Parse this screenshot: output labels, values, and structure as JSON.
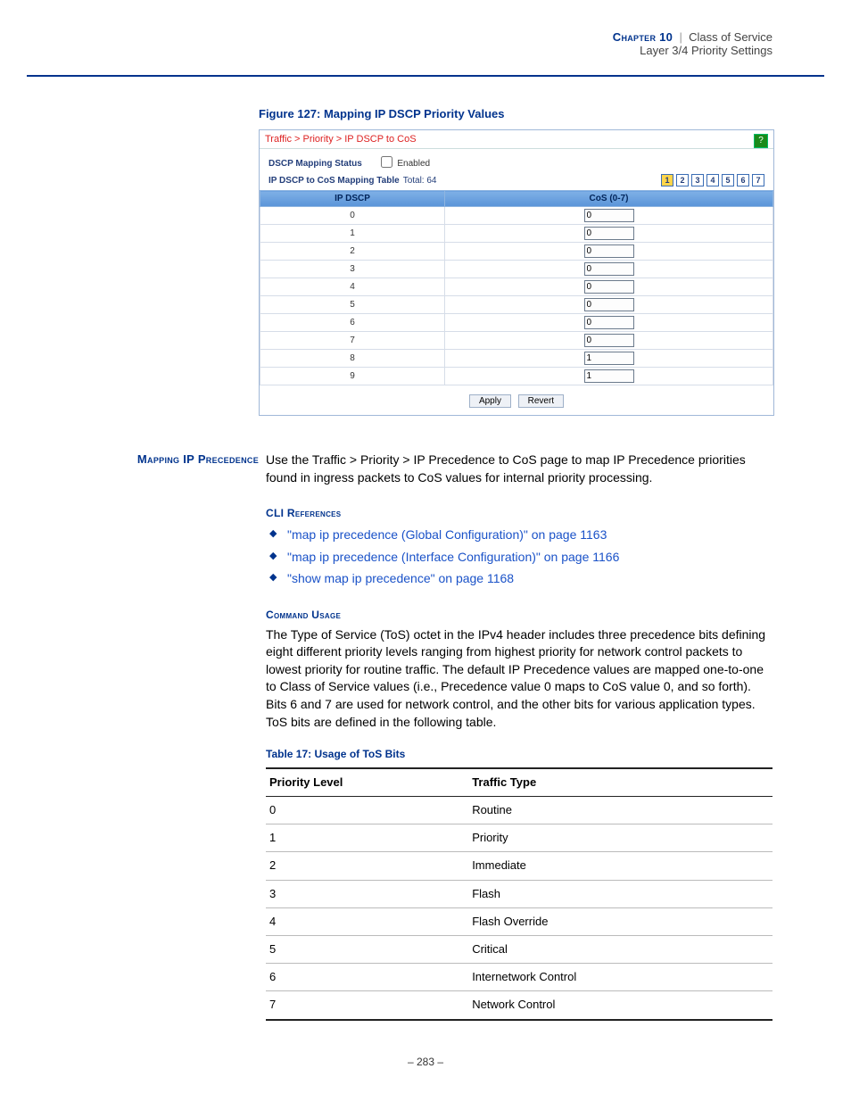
{
  "header": {
    "chapter": "Chapter 10",
    "title": "Class of Service",
    "subtitle": "Layer 3/4 Priority Settings"
  },
  "figure": {
    "caption": "Figure 127:  Mapping IP DSCP Priority Values",
    "breadcrumb": "Traffic > Priority > IP DSCP to CoS",
    "status_label": "DSCP Mapping Status",
    "enabled_label": "Enabled",
    "table_title": "IP DSCP to CoS Mapping Table",
    "total": "Total: 64",
    "pages": [
      "1",
      "2",
      "3",
      "4",
      "5",
      "6",
      "7"
    ],
    "col1": "IP DSCP",
    "col2": "CoS (0-7)",
    "rows": [
      {
        "dscp": "0",
        "cos": "0"
      },
      {
        "dscp": "1",
        "cos": "0"
      },
      {
        "dscp": "2",
        "cos": "0"
      },
      {
        "dscp": "3",
        "cos": "0"
      },
      {
        "dscp": "4",
        "cos": "0"
      },
      {
        "dscp": "5",
        "cos": "0"
      },
      {
        "dscp": "6",
        "cos": "0"
      },
      {
        "dscp": "7",
        "cos": "0"
      },
      {
        "dscp": "8",
        "cos": "1"
      },
      {
        "dscp": "9",
        "cos": "1"
      }
    ],
    "apply": "Apply",
    "revert": "Revert"
  },
  "section": {
    "heading": "Mapping IP Precedence",
    "intro": "Use the Traffic > Priority > IP Precedence to CoS page to map IP Precedence priorities found in ingress packets to CoS values for internal priority processing.",
    "cli_head": "CLI References",
    "cli": [
      "\"map ip precedence (Global Configuration)\" on page 1163",
      "\"map ip precedence (Interface Configuration)\" on page 1166",
      "\"show map ip precedence\" on page 1168"
    ],
    "cmd_head": "Command Usage",
    "cmd_body": "The Type of Service (ToS) octet in the IPv4 header includes three precedence bits defining eight different priority levels ranging from highest priority for network control packets to lowest priority for routine traffic. The default IP Precedence values are mapped one-to-one to Class of Service values (i.e., Precedence value 0 maps to CoS value 0, and so forth). Bits 6 and 7 are used for network control, and the other bits for various application types. ToS bits are defined in the following table."
  },
  "table": {
    "caption": "Table 17: Usage of ToS Bits",
    "h1": "Priority Level",
    "h2": "Traffic Type",
    "rows": [
      {
        "p": "0",
        "t": "Routine"
      },
      {
        "p": "1",
        "t": "Priority"
      },
      {
        "p": "2",
        "t": "Immediate"
      },
      {
        "p": "3",
        "t": "Flash"
      },
      {
        "p": "4",
        "t": "Flash Override"
      },
      {
        "p": "5",
        "t": "Critical"
      },
      {
        "p": "6",
        "t": "Internetwork Control"
      },
      {
        "p": "7",
        "t": "Network Control"
      }
    ]
  },
  "pagenum": "–  283  –"
}
